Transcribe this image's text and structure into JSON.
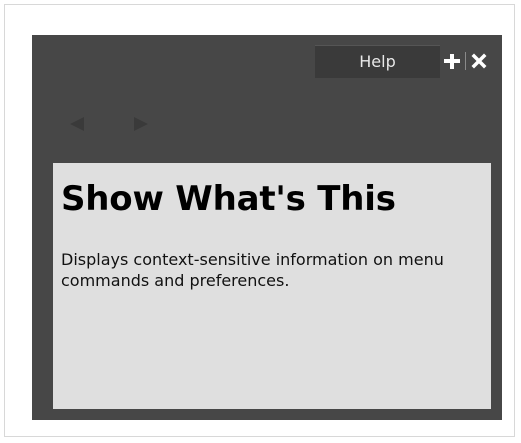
{
  "window": {
    "tab_label": "Help"
  },
  "toolbar": {
    "add_icon": "plus-icon",
    "close_icon": "close-icon"
  },
  "navigation": {
    "back_icon": "back-arrow-icon",
    "forward_icon": "forward-arrow-icon"
  },
  "content": {
    "title": "Show What's This",
    "description": "Displays context-sensitive information on menu commands and preferences."
  },
  "colors": {
    "panel_background": "#474747",
    "tab_background": "#3a3a3a",
    "content_background": "#dfdfdf",
    "arrow_color": "#3a3a3a"
  }
}
